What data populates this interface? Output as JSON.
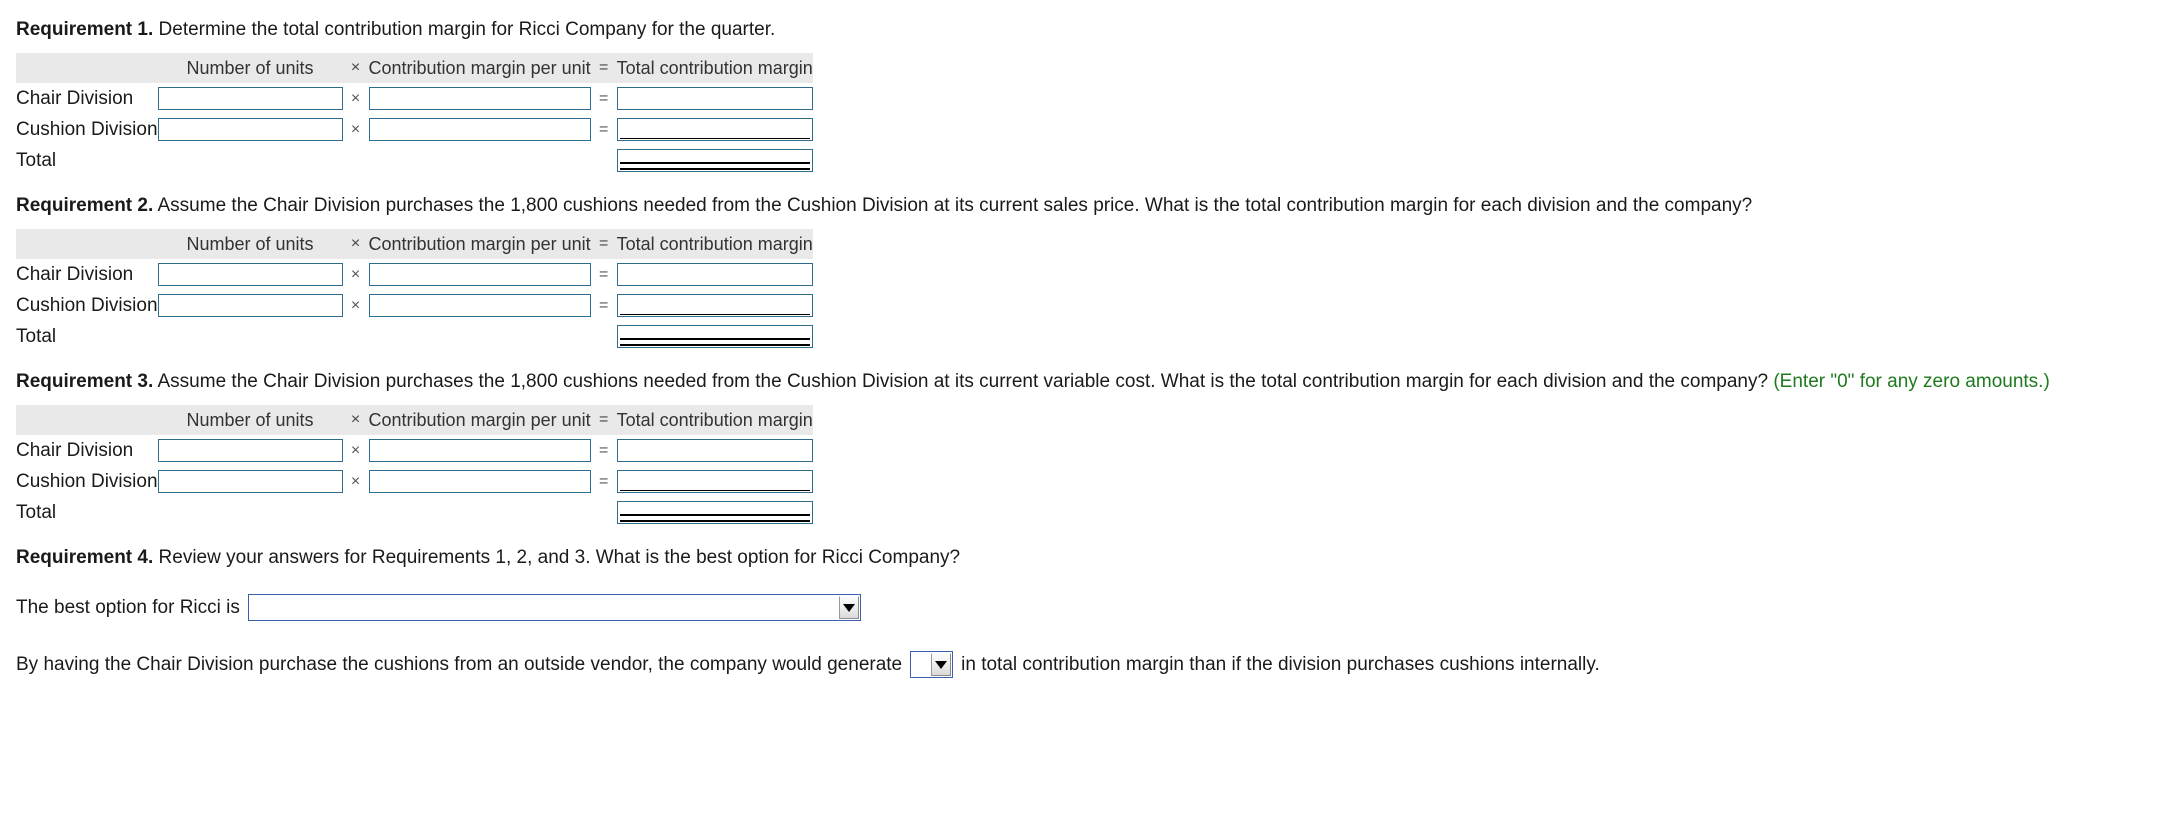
{
  "table_headers": {
    "blank": "",
    "units": "Number of units",
    "times": "×",
    "cmpu": "Contribution margin per unit",
    "equals": "=",
    "total": "Total contribution margin"
  },
  "row_labels": {
    "chair": "Chair Division",
    "cushion": "Cushion Division",
    "total": "Total"
  },
  "requirements": [
    {
      "label": "Requirement 1.",
      "text": "Determine the total contribution margin for Ricci Company for the quarter.",
      "hint": ""
    },
    {
      "label": "Requirement 2.",
      "text": "Assume the Chair Division purchases the 1,800 cushions needed from the Cushion Division at its current sales price. What is the total contribution margin for each division and the company?",
      "hint": ""
    },
    {
      "label": "Requirement 3.",
      "text": "Assume the Chair Division purchases the 1,800 cushions needed from the Cushion Division at its current variable cost. What is the total contribution margin for each division and the company?",
      "hint": "(Enter \"0\" for any zero amounts.)"
    },
    {
      "label": "Requirement 4.",
      "text": "Review your answers for Requirements 1, 2, and 3. What is the best option for Ricci Company?",
      "hint": ""
    }
  ],
  "req4": {
    "prompt": "The best option for Ricci is",
    "dropdown_value": "",
    "sentence_before": "By having the Chair Division purchase the cushions from an outside vendor, the company would generate",
    "inline_dropdown_value": "",
    "sentence_after": "in total contribution margin than if the division purchases cushions internally."
  },
  "colors": {
    "input_border": "#2e6d8e",
    "header_bg": "#e9e9e9",
    "hint_green": "#1f7a1f",
    "dropdown_border": "#3b5fb0"
  }
}
